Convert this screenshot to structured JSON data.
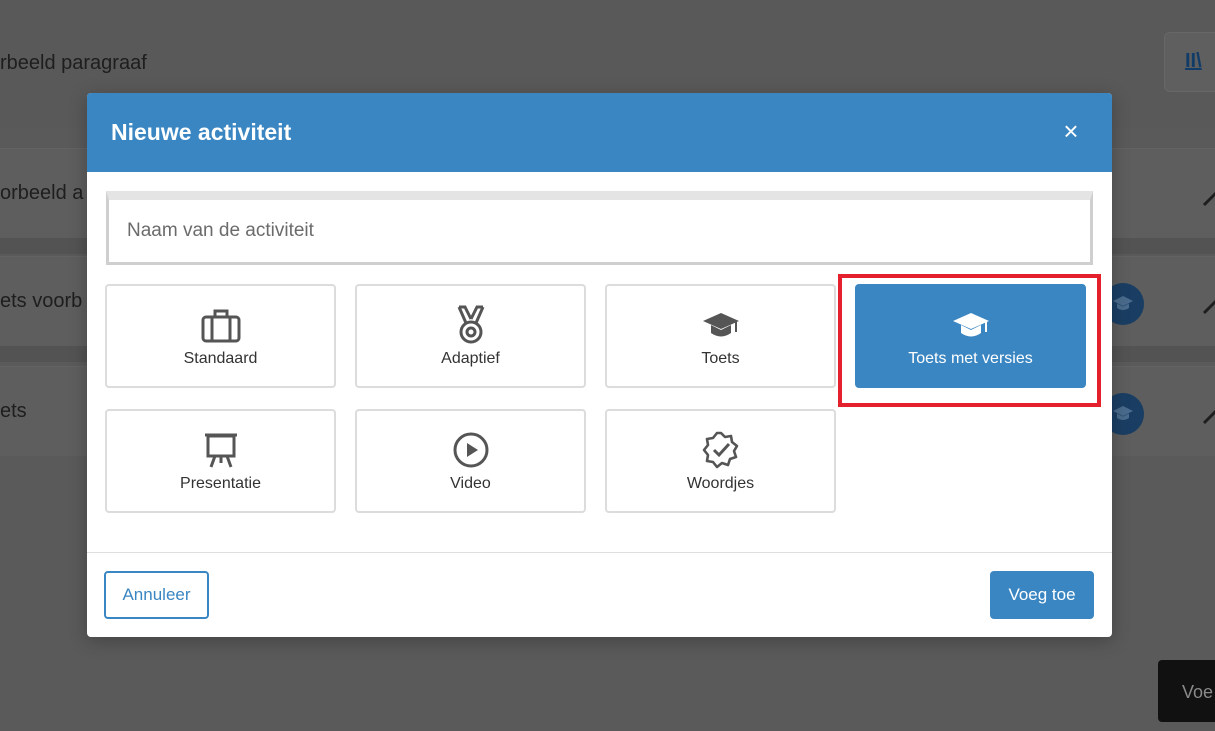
{
  "background": {
    "title": "rbeeld paragraaf",
    "top_button_label": "II\\",
    "rows": [
      {
        "text": "orbeeld a",
        "has_badge": false
      },
      {
        "text": "ets voorb",
        "has_badge": true
      },
      {
        "text": "ets",
        "has_badge": true
      }
    ],
    "corner_button_label": "Voe"
  },
  "modal": {
    "title": "Nieuwe activiteit",
    "close_label": "×",
    "name_input": {
      "placeholder": "Naam van de activiteit",
      "value": ""
    },
    "activity_types": [
      {
        "label": "Standaard",
        "icon": "briefcase-icon",
        "selected": false
      },
      {
        "label": "Adaptief",
        "icon": "medal-icon",
        "selected": false
      },
      {
        "label": "Toets",
        "icon": "graduation-cap-icon",
        "selected": false
      },
      {
        "label": "Toets met versies",
        "icon": "graduation-cap-icon",
        "selected": true
      },
      {
        "label": "Presentatie",
        "icon": "presentation-board-icon",
        "selected": false
      },
      {
        "label": "Video",
        "icon": "play-circle-icon",
        "selected": false
      },
      {
        "label": "Woordjes",
        "icon": "badge-check-icon",
        "selected": false
      }
    ],
    "cancel_label": "Annuleer",
    "add_label": "Voeg toe"
  },
  "colors": {
    "primary": "#3a86c2",
    "highlight": "#e3202c",
    "overlay": "#5a5a5a"
  }
}
